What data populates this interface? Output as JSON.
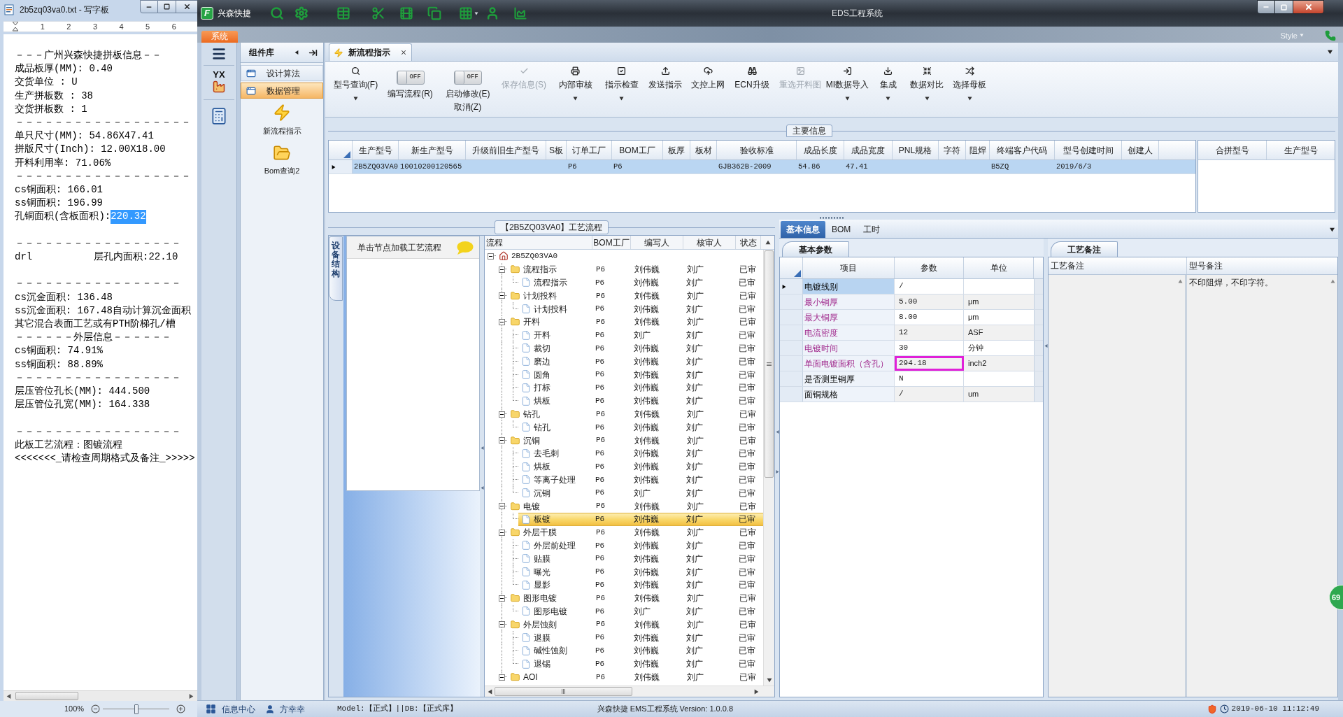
{
  "notepad": {
    "title": "2b5zq03va0.txt - 写字板",
    "ruler": [
      "1",
      "2",
      "3",
      "4",
      "5",
      "6"
    ],
    "lines": [
      {
        "kind": "text",
        "text": "－－－广州兴森快捷拼板信息－－"
      },
      {
        "kind": "text",
        "text": "成品板厚(MM): 0.40"
      },
      {
        "kind": "text",
        "text": "交货单位 : U"
      },
      {
        "kind": "text",
        "text": "生产拼板数 : 38"
      },
      {
        "kind": "text",
        "text": "交货拼板数 : 1"
      },
      {
        "kind": "text",
        "text": "－－－－－－－－－－－－－－－－－－"
      },
      {
        "kind": "text",
        "text": "单只尺寸(MM): 54.86X47.41"
      },
      {
        "kind": "text",
        "text": "拼版尺寸(Inch): 12.00X18.00"
      },
      {
        "kind": "text",
        "text": "开料利用率: 71.06%"
      },
      {
        "kind": "text",
        "text": "－－－－－－－－－－－－－－－－－－"
      },
      {
        "kind": "text",
        "text": "cs铜面积: 166.01"
      },
      {
        "kind": "text",
        "text": "ss铜面积: 196.99"
      },
      {
        "kind": "selection",
        "text": "孔铜面积(含板面积): ",
        "selection": "220.32"
      },
      {
        "kind": "blank"
      },
      {
        "kind": "text",
        "text": "－－－－－－－－－－－－－－－－－"
      },
      {
        "kind": "columns",
        "columns": [
          "drl",
          "层孔内面积:22.10"
        ]
      },
      {
        "kind": "blank"
      },
      {
        "kind": "text",
        "text": "－－－－－－－－－－－－－－－－－"
      },
      {
        "kind": "text",
        "text": "cs沉金面积: 136.48"
      },
      {
        "kind": "text",
        "text": "ss沉金面积: 167.48自动计算沉金面积"
      },
      {
        "kind": "text",
        "text": "其它混合表面工艺或有PTH阶梯孔/槽"
      },
      {
        "kind": "text",
        "text": "－－－－－－外层信息－－－－－－"
      },
      {
        "kind": "text",
        "text": "cs铜面积: 74.91%"
      },
      {
        "kind": "text",
        "text": "ss铜面积: 88.89%"
      },
      {
        "kind": "text",
        "text": "－－－－－－－－－－－－－－－－－"
      },
      {
        "kind": "text",
        "text": "层压管位孔长(MM): 444.500"
      },
      {
        "kind": "text",
        "text": "层压管位孔宽(MM): 164.338"
      },
      {
        "kind": "blank"
      },
      {
        "kind": "text",
        "text": "－－－－－－－－－－－－－－－－－"
      },
      {
        "kind": "text",
        "text": "此板工艺流程：图镀流程"
      },
      {
        "kind": "text",
        "text": "<<<<<<<_请检查周期格式及备注_>>>>>"
      }
    ],
    "zoom": {
      "label": "100%",
      "level": 0.5
    }
  },
  "app": {
    "logo": "F",
    "brand": "兴森快捷",
    "title": "EDS工程系统",
    "ribbon_tab": "系统",
    "style_menu": "Style",
    "nav_badge": "YX",
    "components": {
      "title": "组件库",
      "items": [
        {
          "label": "设计算法",
          "selected": false
        },
        {
          "label": "数据管理",
          "selected": true
        }
      ],
      "tiles": [
        {
          "kind": "flow",
          "label": "新流程指示"
        },
        {
          "kind": "query",
          "label": "Bom查询2"
        }
      ]
    },
    "doc_tab": "新流程指示",
    "toolbar": [
      {
        "kind": "button",
        "label": "型号查询(F)",
        "dropdown": true,
        "disabled": false
      },
      {
        "kind": "toggle",
        "switch_text": "OFF",
        "on": false,
        "label": "编写流程(R)"
      },
      {
        "kind": "toggle",
        "switch_text": "OFF",
        "on": false,
        "label": "启动修改(E)",
        "sublabel": "取消(Z)"
      },
      {
        "kind": "button",
        "label": "保存信息(S)",
        "dropdown": false,
        "disabled": true
      },
      {
        "kind": "button",
        "label": "内部审核",
        "dropdown": true,
        "disabled": false
      },
      {
        "kind": "button",
        "label": "指示检查",
        "dropdown": true,
        "disabled": false
      },
      {
        "kind": "button",
        "label": "发送指示",
        "dropdown": false,
        "disabled": false
      },
      {
        "kind": "button",
        "label": "文控上网",
        "dropdown": false,
        "disabled": false
      },
      {
        "kind": "button",
        "label": "ECN升级",
        "dropdown": false,
        "disabled": false
      },
      {
        "kind": "button",
        "label": "重选开料图",
        "dropdown": false,
        "disabled": true
      },
      {
        "kind": "button",
        "label": "MI数据导入",
        "dropdown": true,
        "disabled": false
      },
      {
        "kind": "button",
        "label": "集成",
        "dropdown": true,
        "disabled": false
      },
      {
        "kind": "button",
        "label": "数据对比",
        "dropdown": true,
        "disabled": false
      },
      {
        "kind": "button",
        "label": "选择母板",
        "dropdown": true,
        "disabled": false
      }
    ],
    "main_info": {
      "caption": "主要信息",
      "columns": [
        "生产型号",
        "新生产型号",
        "升级前旧生产型号",
        "S板",
        "订单工厂",
        "BOM工厂",
        "板厚",
        "板材",
        "验收标准",
        "成品长度",
        "成品宽度",
        "PNL规格",
        "字符",
        "阻焊",
        "终端客户代码",
        "型号创建时间",
        "创建人"
      ],
      "rows": [
        {
          "selected": true,
          "cells": [
            "2B5ZQ03VA0",
            "10010200120565",
            null,
            null,
            "P6",
            "P6",
            null,
            null,
            "GJB362B-2009",
            "54.86",
            "47.41",
            null,
            null,
            null,
            "B5ZQ",
            "2019/6/3",
            null
          ]
        }
      ],
      "side_columns": [
        "合拼型号",
        "生产型号"
      ]
    },
    "process": {
      "caption": "【2B5ZQ03VA0】工艺流程",
      "side_tab": "设备结构",
      "hint": "单击节点加载工艺流程",
      "columns": [
        "流程",
        "BOM工厂",
        "编写人",
        "核审人",
        "状态"
      ],
      "tree": [
        {
          "kind": "root",
          "name": "2B5ZQ03VA0",
          "expanded": true,
          "selected": false,
          "children": [
            {
              "kind": "folder",
              "name": "流程指示",
              "factory": "P6",
              "writer": "刘伟巍",
              "reviewer": "刘广",
              "status": "已审",
              "expanded": true,
              "selected": false,
              "children": [
                {
                  "kind": "step",
                  "name": "流程指示",
                  "factory": "P6",
                  "writer": "刘伟巍",
                  "reviewer": "刘广",
                  "status": "已审",
                  "selected": false
                }
              ]
            },
            {
              "kind": "folder",
              "name": "计划投料",
              "factory": "P6",
              "writer": "刘伟巍",
              "reviewer": "刘广",
              "status": "已审",
              "expanded": true,
              "selected": false,
              "children": [
                {
                  "kind": "step",
                  "name": "计划投料",
                  "factory": "P6",
                  "writer": "刘伟巍",
                  "reviewer": "刘广",
                  "status": "已审",
                  "selected": false
                }
              ]
            },
            {
              "kind": "folder",
              "name": "开料",
              "factory": "P6",
              "writer": "刘伟巍",
              "reviewer": "刘广",
              "status": "已审",
              "expanded": true,
              "selected": false,
              "children": [
                {
                  "kind": "step",
                  "name": "开料",
                  "factory": "P6",
                  "writer": "刘广",
                  "reviewer": "刘广",
                  "status": "已审",
                  "selected": false
                },
                {
                  "kind": "step",
                  "name": "裁切",
                  "factory": "P6",
                  "writer": "刘伟巍",
                  "reviewer": "刘广",
                  "status": "已审",
                  "selected": false
                },
                {
                  "kind": "step",
                  "name": "磨边",
                  "factory": "P6",
                  "writer": "刘伟巍",
                  "reviewer": "刘广",
                  "status": "已审",
                  "selected": false
                },
                {
                  "kind": "step",
                  "name": "圆角",
                  "factory": "P6",
                  "writer": "刘伟巍",
                  "reviewer": "刘广",
                  "status": "已审",
                  "selected": false
                },
                {
                  "kind": "step",
                  "name": "打标",
                  "factory": "P6",
                  "writer": "刘伟巍",
                  "reviewer": "刘广",
                  "status": "已审",
                  "selected": false
                },
                {
                  "kind": "step",
                  "name": "烘板",
                  "factory": "P6",
                  "writer": "刘伟巍",
                  "reviewer": "刘广",
                  "status": "已审",
                  "selected": false
                }
              ]
            },
            {
              "kind": "folder",
              "name": "钻孔",
              "factory": "P6",
              "writer": "刘伟巍",
              "reviewer": "刘广",
              "status": "已审",
              "expanded": true,
              "selected": false,
              "children": [
                {
                  "kind": "step",
                  "name": "钻孔",
                  "factory": "P6",
                  "writer": "刘伟巍",
                  "reviewer": "刘广",
                  "status": "已审",
                  "selected": false
                }
              ]
            },
            {
              "kind": "folder",
              "name": "沉铜",
              "factory": "P6",
              "writer": "刘伟巍",
              "reviewer": "刘广",
              "status": "已审",
              "expanded": true,
              "selected": false,
              "children": [
                {
                  "kind": "step",
                  "name": "去毛刺",
                  "factory": "P6",
                  "writer": "刘伟巍",
                  "reviewer": "刘广",
                  "status": "已审",
                  "selected": false
                },
                {
                  "kind": "step",
                  "name": "烘板",
                  "factory": "P6",
                  "writer": "刘伟巍",
                  "reviewer": "刘广",
                  "status": "已审",
                  "selected": false
                },
                {
                  "kind": "step",
                  "name": "等离子处理",
                  "factory": "P6",
                  "writer": "刘伟巍",
                  "reviewer": "刘广",
                  "status": "已审",
                  "selected": false
                },
                {
                  "kind": "step",
                  "name": "沉铜",
                  "factory": "P6",
                  "writer": "刘广",
                  "reviewer": "刘广",
                  "status": "已审",
                  "selected": false
                }
              ]
            },
            {
              "kind": "folder",
              "name": "电镀",
              "factory": "P6",
              "writer": "刘伟巍",
              "reviewer": "刘广",
              "status": "已审",
              "expanded": true,
              "selected": false,
              "children": [
                {
                  "kind": "step",
                  "name": "板镀",
                  "factory": "P6",
                  "writer": "刘伟巍",
                  "reviewer": "刘广",
                  "status": "已审",
                  "selected": true
                }
              ]
            },
            {
              "kind": "folder",
              "name": "外层干膜",
              "factory": "P6",
              "writer": "刘伟巍",
              "reviewer": "刘广",
              "status": "已审",
              "expanded": true,
              "selected": false,
              "children": [
                {
                  "kind": "step",
                  "name": "外层前处理",
                  "factory": "P6",
                  "writer": "刘伟巍",
                  "reviewer": "刘广",
                  "status": "已审",
                  "selected": false
                },
                {
                  "kind": "step",
                  "name": "贴膜",
                  "factory": "P6",
                  "writer": "刘伟巍",
                  "reviewer": "刘广",
                  "status": "已审",
                  "selected": false
                },
                {
                  "kind": "step",
                  "name": "曝光",
                  "factory": "P6",
                  "writer": "刘伟巍",
                  "reviewer": "刘广",
                  "status": "已审",
                  "selected": false
                },
                {
                  "kind": "step",
                  "name": "显影",
                  "factory": "P6",
                  "writer": "刘伟巍",
                  "reviewer": "刘广",
                  "status": "已审",
                  "selected": false
                }
              ]
            },
            {
              "kind": "folder",
              "name": "图形电镀",
              "factory": "P6",
              "writer": "刘伟巍",
              "reviewer": "刘广",
              "status": "已审",
              "expanded": true,
              "selected": false,
              "children": [
                {
                  "kind": "step",
                  "name": "图形电镀",
                  "factory": "P6",
                  "writer": "刘广",
                  "reviewer": "刘广",
                  "status": "已审",
                  "selected": false
                }
              ]
            },
            {
              "kind": "folder",
              "name": "外层蚀刻",
              "factory": "P6",
              "writer": "刘伟巍",
              "reviewer": "刘广",
              "status": "已审",
              "expanded": true,
              "selected": false,
              "children": [
                {
                  "kind": "step",
                  "name": "退膜",
                  "factory": "P6",
                  "writer": "刘伟巍",
                  "reviewer": "刘广",
                  "status": "已审",
                  "selected": false
                },
                {
                  "kind": "step",
                  "name": "碱性蚀刻",
                  "factory": "P6",
                  "writer": "刘伟巍",
                  "reviewer": "刘广",
                  "status": "已审",
                  "selected": false
                },
                {
                  "kind": "step",
                  "name": "退锡",
                  "factory": "P6",
                  "writer": "刘伟巍",
                  "reviewer": "刘广",
                  "status": "已审",
                  "selected": false
                }
              ]
            },
            {
              "kind": "folder",
              "name": "AOI",
              "factory": "P6",
              "writer": "刘伟巍",
              "reviewer": "刘广",
              "status": "已审",
              "expanded": true,
              "selected": false
            }
          ]
        }
      ]
    },
    "details": {
      "tabs": [
        {
          "label": "基本信息",
          "selected": true
        },
        {
          "label": "BOM",
          "selected": false
        },
        {
          "label": "工时",
          "selected": false
        }
      ],
      "params": {
        "tab": "基本参数",
        "columns": [
          "项目",
          "参数",
          "单位"
        ],
        "rows": [
          {
            "item": "电镀线别",
            "value": "/",
            "highlighted": false,
            "selected": true,
            "marked": false
          },
          {
            "item": "最小铜厚",
            "value": "5.00",
            "unit": "μm",
            "highlighted": true,
            "selected": false,
            "marked": false
          },
          {
            "item": "最大铜厚",
            "value": "8.00",
            "unit": "μm",
            "highlighted": true,
            "selected": false,
            "marked": false
          },
          {
            "item": "电流密度",
            "value": "12",
            "unit": "ASF",
            "highlighted": true,
            "selected": false,
            "marked": false
          },
          {
            "item": "电镀时间",
            "value": "30",
            "unit": "分钟",
            "highlighted": true,
            "selected": false,
            "marked": false
          },
          {
            "item": "单面电镀面积（含孔）",
            "value": "294.18",
            "unit": "inch2",
            "highlighted": true,
            "selected": false,
            "marked": true
          },
          {
            "item": "是否测里铜厚",
            "value": "N",
            "highlighted": false,
            "selected": false,
            "marked": false
          },
          {
            "item": "面铜规格",
            "value": "/",
            "unit": "um",
            "highlighted": false,
            "selected": false,
            "marked": false
          }
        ]
      },
      "remarks": {
        "tab": "工艺备注",
        "columns": [
          "工艺备注",
          "型号备注"
        ],
        "model_remark": "不印阻焊，不印字符。"
      }
    },
    "status_bar": {
      "items": [
        {
          "kind": "menu",
          "label": "信息中心"
        },
        {
          "kind": "user",
          "label": "方幸幸"
        }
      ],
      "model": "Model:【正式】||DB:【正式库】",
      "version": "兴森快捷 EMS工程系统 Version: 1.0.0.8",
      "datetime": "2019-06-10 11:12:49"
    },
    "badge": "69"
  }
}
